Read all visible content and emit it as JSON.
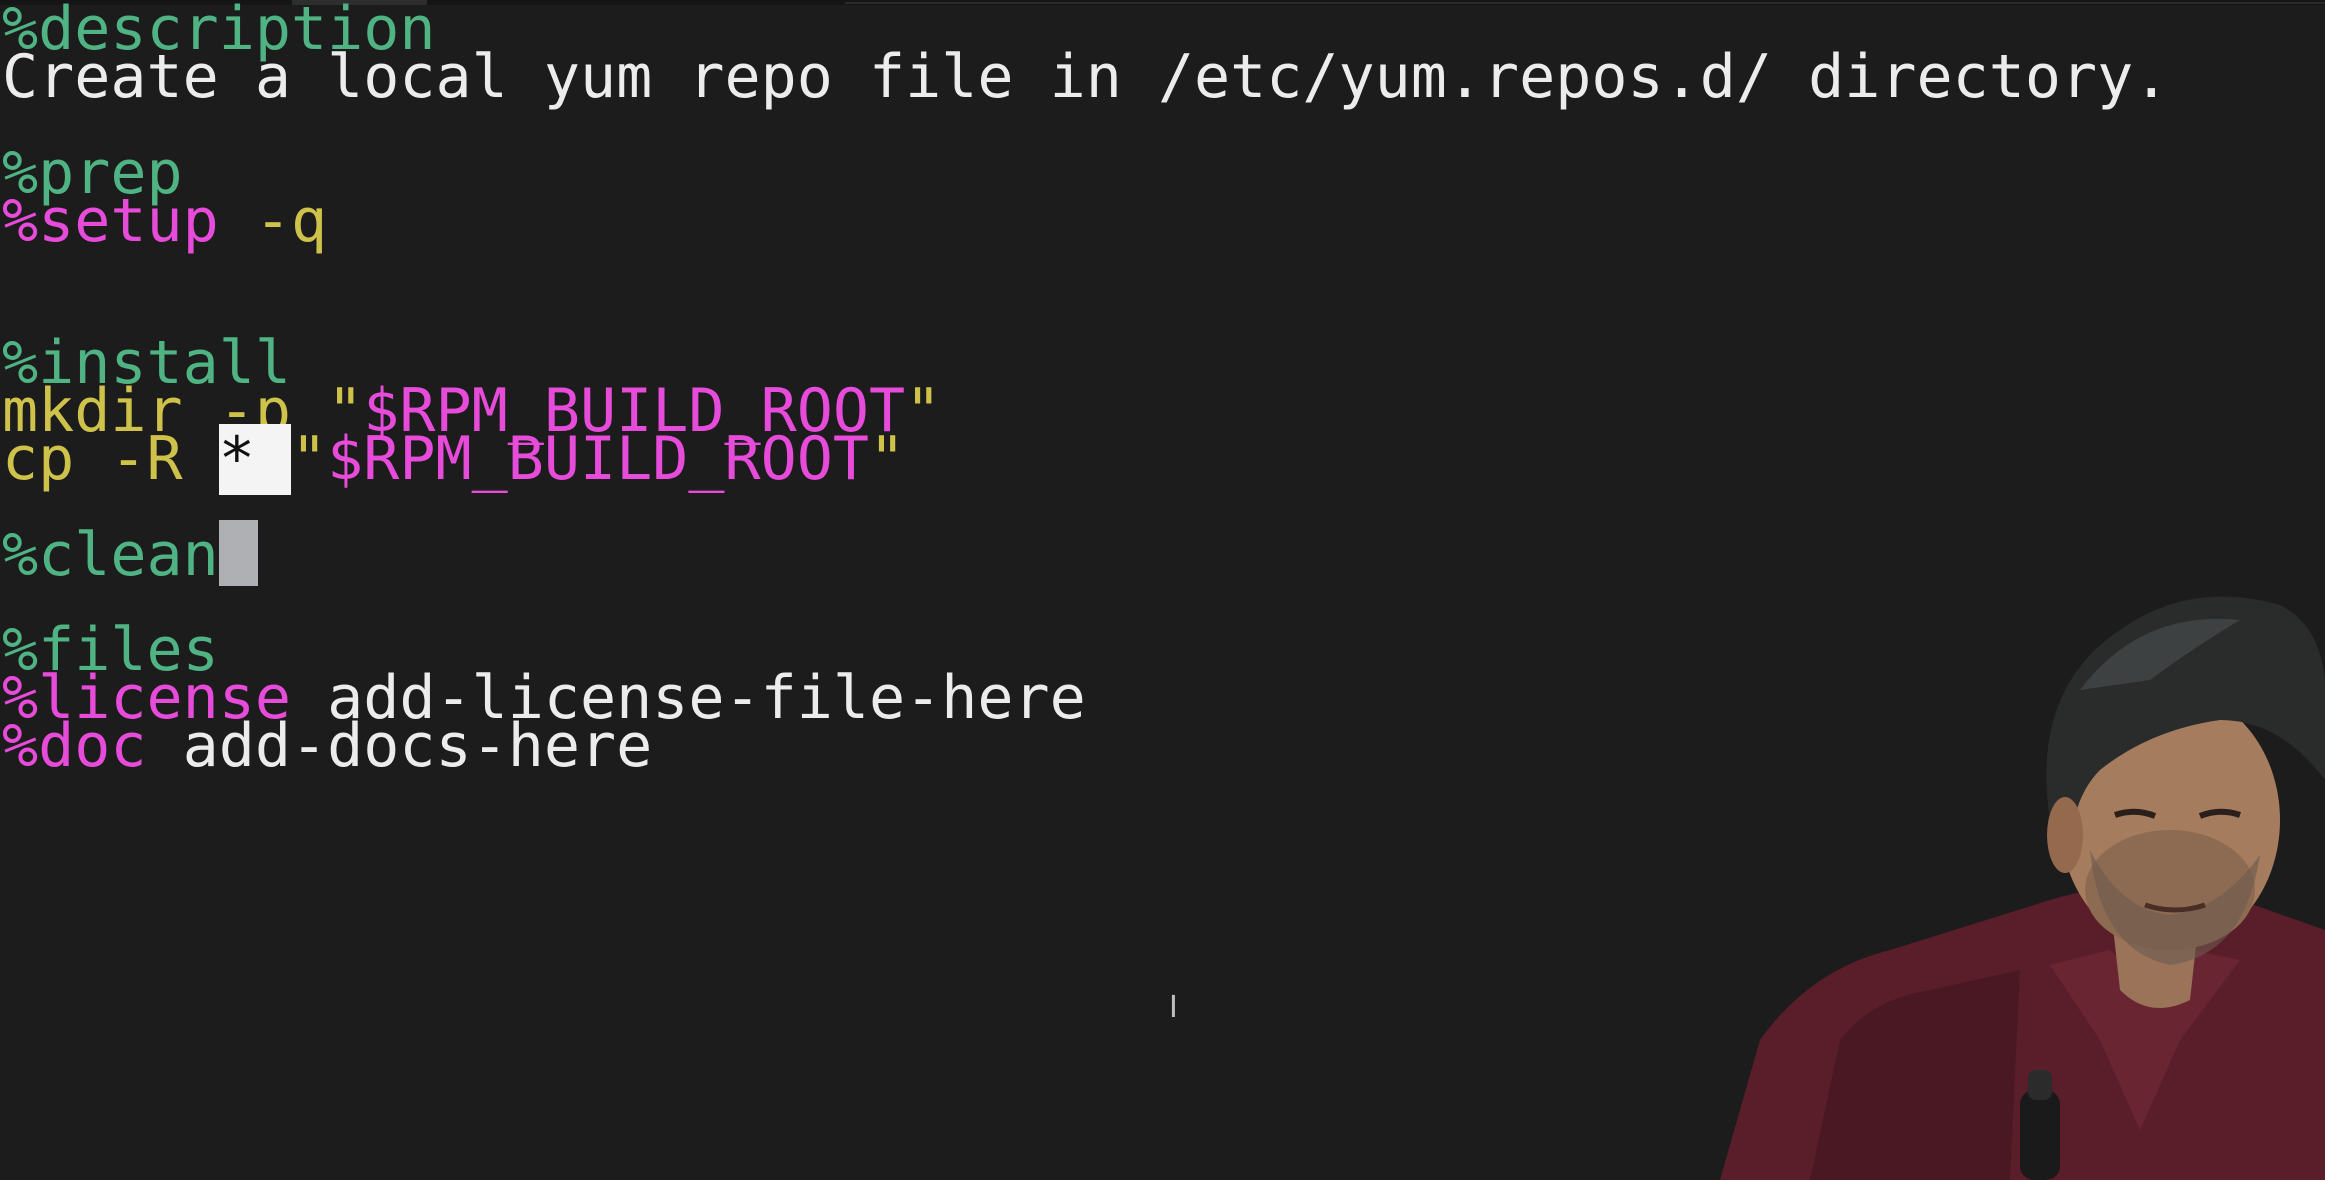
{
  "editor": {
    "lines": {
      "description_directive": "%description",
      "description_text": "Create a local yum repo file in /etc/yum.repos.d/ directory.",
      "prep_directive": "%prep",
      "setup_macro": "%setup",
      "setup_flag": " -q",
      "install_directive": "%install",
      "mkdir_cmd": "mkdir -p \"",
      "mkdir_var": "$RPM_BUILD_ROOT",
      "mkdir_end": "\"",
      "cp_cmd": "cp -R ",
      "cp_glob": "* ",
      "cp_quote_open": "\"",
      "cp_var": "$RPM_BUILD_ROOT",
      "cp_end": "\"",
      "clean_directive": "%clean",
      "files_directive": "%files",
      "license_macro": "%license",
      "license_value": " add-license-file-here",
      "doc_macro": "%doc",
      "doc_value": " add-docs-here"
    },
    "mouse_cursor": "I"
  },
  "colors": {
    "background": "#1c1c1c",
    "directive_green": "#4fb383",
    "macro_pink": "#e64bd9",
    "command_yellow": "#cfc24a",
    "variable_cyan": "#5fbbe0",
    "plain_text": "#ececec",
    "cursor_block": "#aeb0b4"
  },
  "overlay": {
    "webcam": "presenter webcam feed"
  }
}
